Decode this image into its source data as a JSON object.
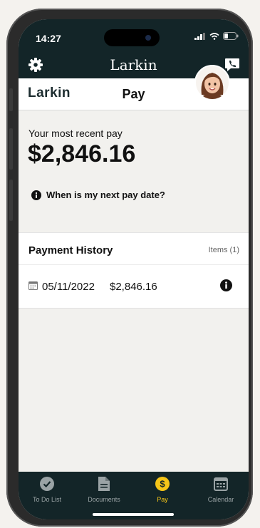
{
  "status_bar": {
    "time": "14:27"
  },
  "app_bar": {
    "brand": "Larkin",
    "icons": [
      "gear-icon",
      "phone-chat-icon"
    ]
  },
  "header": {
    "logo": "Larkin",
    "title": "Pay"
  },
  "pay": {
    "recent_label": "Your most recent pay",
    "amount": "$2,846.16",
    "next_pay_link": "When is my next pay date?"
  },
  "history": {
    "title": "Payment History",
    "items_count": "Items (1)",
    "rows": [
      {
        "date": "05/11/2022",
        "amount": "$2,846.16"
      }
    ]
  },
  "tabs": [
    {
      "label": "To Do List",
      "icon": "check-circle-icon",
      "active": false
    },
    {
      "label": "Documents",
      "icon": "document-icon",
      "active": false
    },
    {
      "label": "Pay",
      "icon": "dollar-icon",
      "active": true
    },
    {
      "label": "Calendar",
      "icon": "calendar-icon",
      "active": false
    }
  ],
  "colors": {
    "dark_bg": "#132528",
    "accent": "#f5c518",
    "screen_bg": "#f2f1ee"
  }
}
